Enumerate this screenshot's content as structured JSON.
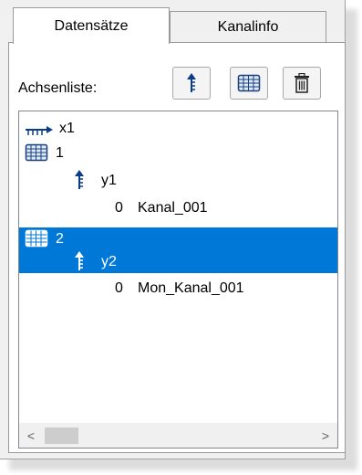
{
  "tabs": [
    {
      "label": "Datensätze",
      "active": true
    },
    {
      "label": "Kanalinfo",
      "active": false
    }
  ],
  "axes_label": "Achsenliste:",
  "toolbar": {
    "buttons": [
      {
        "icon": "y-axis-arrow-icon"
      },
      {
        "icon": "grid-table-icon"
      },
      {
        "icon": "trash-icon"
      }
    ]
  },
  "tree": {
    "items": [
      {
        "icon": "x-axis-arrow-icon",
        "label": "x1",
        "level": 0,
        "selected": false
      },
      {
        "icon": "dataset-icon",
        "label": "1",
        "level": 0,
        "selected": false
      },
      {
        "icon": "y-axis-arrow-icon",
        "label": "y1",
        "level": 1,
        "selected": false
      },
      {
        "icon": "",
        "index": "0",
        "label": "Kanal_001",
        "level": 2,
        "selected": false
      },
      {
        "icon": "dataset-icon",
        "label": "2",
        "level": 0,
        "selected": true
      },
      {
        "icon": "y-axis-arrow-icon",
        "label": "y2",
        "level": 1,
        "selected": true
      },
      {
        "icon": "",
        "index": "0",
        "label": "Mon_Kanal_001",
        "level": 2,
        "selected": false
      }
    ],
    "scrollbar": {
      "left_arrow": "<",
      "right_arrow": ">"
    }
  },
  "colors": {
    "selection": "#0078d7",
    "panel_bg": "#f0f0f0",
    "border": "#9a9a9a"
  }
}
